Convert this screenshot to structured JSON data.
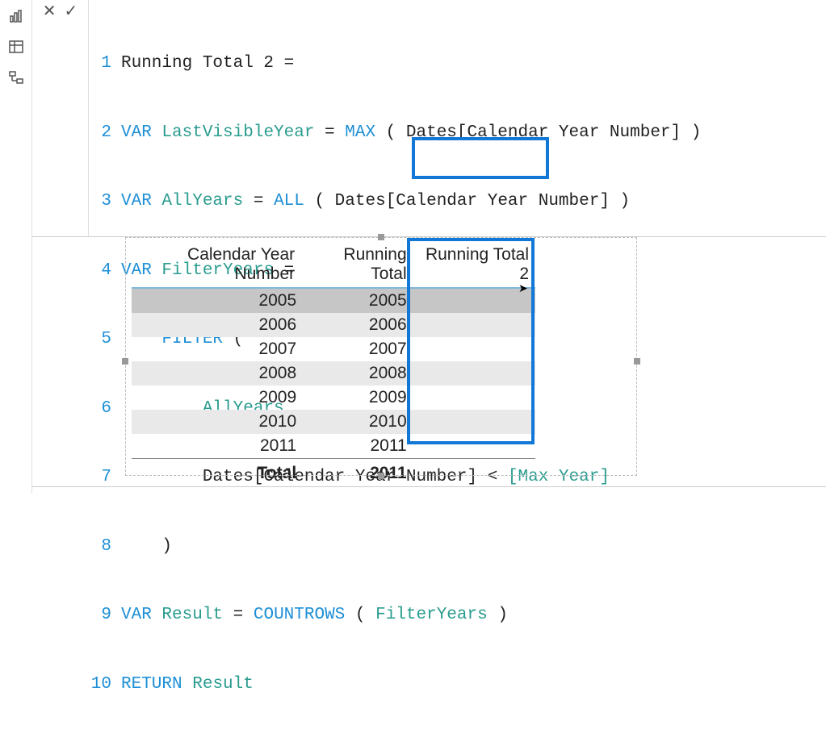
{
  "code": {
    "l1_a": "Running Total 2 =",
    "l2_var": "VAR",
    "l2_name": "LastVisibleYear",
    "l2_eq": " = ",
    "l2_fn": "MAX",
    "l2_rest": " ( Dates[Calendar Year Number] )",
    "l3_var": "VAR",
    "l3_name": "AllYears",
    "l3_eq": " = ",
    "l3_fn": "ALL",
    "l3_rest": " ( Dates[Calendar Year Number] )",
    "l4_var": "VAR",
    "l4_name": "FilterYears",
    "l4_eq": " =",
    "l5_fn": "FILTER",
    "l5_rest": " (",
    "l6_name": "AllYears",
    "l6_rest": ",",
    "l7_a": "Dates[Calendar Year Number]",
    "l7_b": " < ",
    "l7_c": "[Max Year]",
    "l8_rest": ")",
    "l9_var": "VAR",
    "l9_name": "Result",
    "l9_eq": " = ",
    "l9_fn": "COUNTROWS",
    "l9_paren1": " ( ",
    "l9_arg": "FilterYears",
    "l9_paren2": " )",
    "l10_ret": "RETURN",
    "l10_name": "Result",
    "lineno": {
      "1": "1",
      "2": "2",
      "3": "3",
      "4": "4",
      "5": "5",
      "6": "6",
      "7": "7",
      "8": "8",
      "9": "9",
      "10": "10"
    }
  },
  "table": {
    "headers": {
      "year": "Calendar Year Number",
      "rt": "Running Total",
      "rt2": "Running Total 2"
    },
    "rows": [
      {
        "year": "2005",
        "rt": "2005",
        "rt2": ""
      },
      {
        "year": "2006",
        "rt": "2006",
        "rt2": ""
      },
      {
        "year": "2007",
        "rt": "2007",
        "rt2": ""
      },
      {
        "year": "2008",
        "rt": "2008",
        "rt2": ""
      },
      {
        "year": "2009",
        "rt": "2009",
        "rt2": ""
      },
      {
        "year": "2010",
        "rt": "2010",
        "rt2": ""
      },
      {
        "year": "2011",
        "rt": "2011",
        "rt2": ""
      }
    ],
    "footer": {
      "label": "Total",
      "rt": "2011",
      "rt2": ""
    }
  }
}
